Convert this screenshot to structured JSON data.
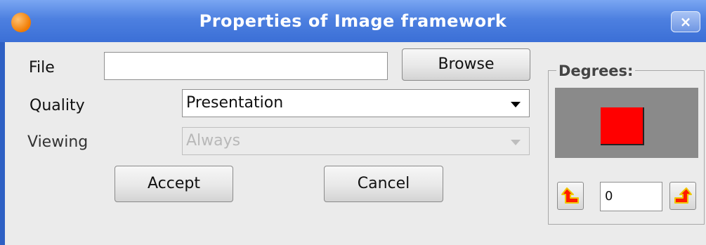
{
  "window": {
    "title": "Properties of Image framework",
    "close_label": "×"
  },
  "form": {
    "file_label": "File",
    "file_value": "",
    "browse_label": "Browse",
    "quality_label": "Quality",
    "quality_value": "Presentation",
    "viewing_label": "Viewing",
    "viewing_value": "Always",
    "accept_label": "Accept",
    "cancel_label": "Cancel"
  },
  "degrees": {
    "legend": "Degrees:",
    "value": "0",
    "preview_color": "#ff0000",
    "rotate_left_icon": "rotate-left-arrow-icon",
    "rotate_right_icon": "rotate-right-arrow-icon"
  },
  "colors": {
    "title_bar": "#4d80e0",
    "window_border": "#2e60c4",
    "background": "#ebebeb",
    "arrow_fill": "#ff1a00",
    "arrow_stroke": "#f0c800"
  }
}
